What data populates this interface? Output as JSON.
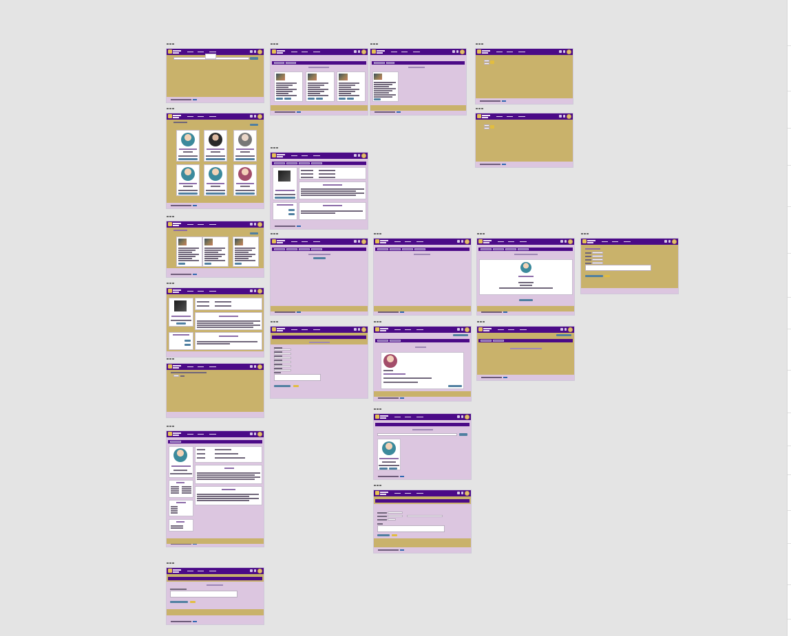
{
  "app": {
    "brand": "Wireframe board",
    "copyright": "© 2023 Commons Mentor Connect",
    "nav_links": [
      "Home",
      "Projects",
      "Search"
    ]
  },
  "frames": [
    {
      "id": "search-users",
      "title": "Search Users"
    },
    {
      "id": "my-saved-projects",
      "title": "My Saved Projects"
    },
    {
      "id": "project-feeds",
      "title": "Project Feeds"
    },
    {
      "id": "login-small-1",
      "title": "Login"
    },
    {
      "id": "login-small-2",
      "title": "Login"
    },
    {
      "id": "user-search-results",
      "title": "User Search Results"
    },
    {
      "id": "project-details",
      "title": "Project Description"
    },
    {
      "id": "project-search",
      "title": "Project Search"
    },
    {
      "id": "project-foundation",
      "title": "Project Foundation"
    },
    {
      "id": "edit-profile",
      "title": "Edit Profile"
    },
    {
      "id": "my-profile",
      "title": "My Profile"
    },
    {
      "id": "upcoming-meetings",
      "title": "Upcoming Meetings"
    },
    {
      "id": "past-meetings",
      "title": "Past Meetings"
    },
    {
      "id": "project-meeting-detail",
      "title": "Project Meeting Detail"
    },
    {
      "id": "edit-meetings",
      "title": "Edit Meetings"
    },
    {
      "id": "create-a-meeting",
      "title": "Create a Meeting"
    },
    {
      "id": "my-jobs",
      "title": "My Jobs"
    },
    {
      "id": "projects-requesting",
      "title": "Projects Requesting Me to Join"
    },
    {
      "id": "search-for-employees",
      "title": "Search for Employees"
    },
    {
      "id": "edit-meeting-form",
      "title": "Edit a Meeting"
    },
    {
      "id": "establish-issue",
      "title": "Establish Issue"
    }
  ],
  "colors": {
    "canvas": "#e4e4e4",
    "nav": "#4b0a87",
    "panel_lavender": "#dcc6e0",
    "panel_gold": "#c9b26b",
    "button_blue": "#4f7fa0",
    "button_yellow": "#e2bd3f"
  }
}
